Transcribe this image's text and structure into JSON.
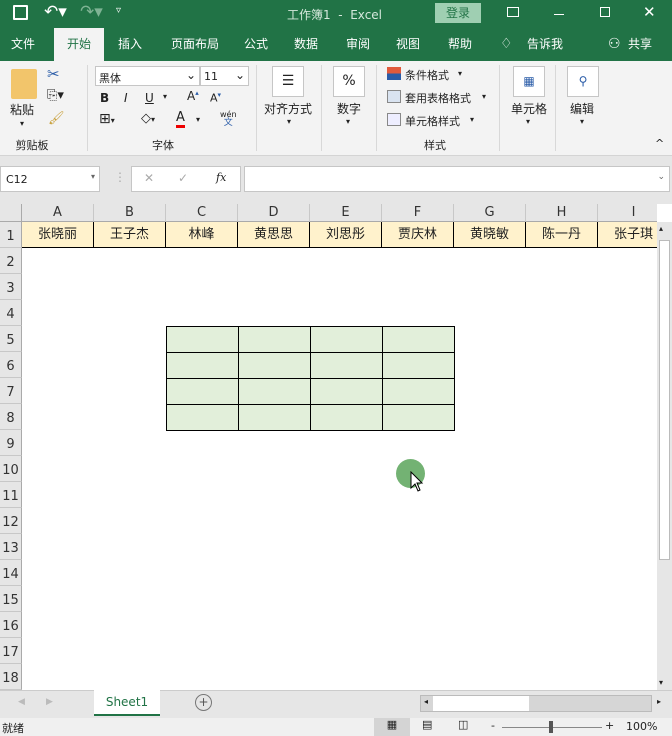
{
  "titlebar": {
    "title": "工作簿1  -  Excel",
    "login": "登录"
  },
  "tabs": [
    "文件",
    "开始",
    "插入",
    "页面布局",
    "公式",
    "数据",
    "审阅",
    "视图",
    "帮助",
    "告诉我",
    "共享"
  ],
  "ribbon": {
    "paste": "粘贴",
    "clipboard": "剪贴板",
    "font_name": "黑体",
    "font_size": "11",
    "bold": "B",
    "italic": "I",
    "underline": "U",
    "font_group": "字体",
    "wen": "wén",
    "wen2": "文",
    "align": "对齐方式",
    "number": "数字",
    "percent": "%",
    "cond_format": "条件格式",
    "table_format": "套用表格格式",
    "cell_style": "单元格样式",
    "styles_group": "样式",
    "cells": "单元格",
    "edit": "编辑"
  },
  "formula_bar": {
    "name_box": "C12",
    "fx": "fx",
    "value": ""
  },
  "columns": [
    "A",
    "B",
    "C",
    "D",
    "E",
    "F",
    "G",
    "H",
    "I"
  ],
  "rows": [
    "1",
    "2",
    "3",
    "4",
    "5",
    "6",
    "7",
    "8",
    "9",
    "10",
    "11",
    "12",
    "13",
    "14",
    "15",
    "16",
    "17",
    "18"
  ],
  "row1_values": [
    "张晓丽",
    "王子杰",
    "林峰",
    "黄思思",
    "刘思彤",
    "贾庆林",
    "黄晓敏",
    "陈一丹",
    "张子琪"
  ],
  "sheet_tab": "Sheet1",
  "status": {
    "ready": "就绪",
    "zoom": "100%"
  },
  "colors": {
    "brand": "#217346",
    "header_fill": "#fff2cc",
    "table_fill": "#e2efda"
  }
}
